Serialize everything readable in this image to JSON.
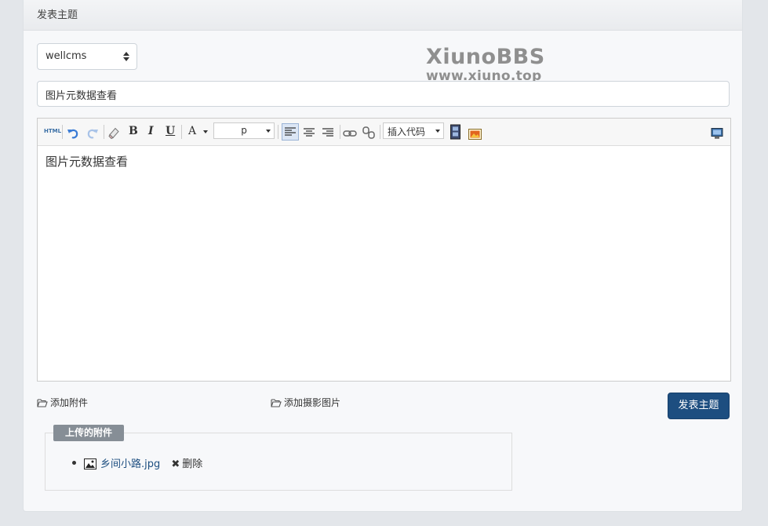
{
  "header": {
    "title": "发表主题"
  },
  "forum_select": {
    "value": "wellcms"
  },
  "watermark": {
    "line1": "XiunoBBS",
    "line2": "www.xiuno.top"
  },
  "subject": {
    "value": "图片元数据查看"
  },
  "toolbar": {
    "html_label": "HTML",
    "bold": "B",
    "italic": "I",
    "underline": "U",
    "font_color": "A",
    "font_size_value": "p",
    "insert_code_value": "插入代码"
  },
  "editor": {
    "content": "图片元数据查看"
  },
  "actions": {
    "add_attachment": "添加附件",
    "add_photo": "添加摄影图片",
    "publish": "发表主题"
  },
  "attachments": {
    "legend": "上传的附件",
    "items": [
      {
        "filename": "乡间小路.jpg",
        "delete_label": "删除"
      }
    ]
  },
  "icons": {
    "undo": "undo-icon",
    "redo": "redo-icon",
    "eraser": "eraser-icon",
    "link": "link-icon",
    "unlink": "unlink-icon",
    "video": "video-icon",
    "image": "image-icon",
    "fullscreen": "monitor-icon",
    "folder": "folder-open-icon",
    "picture": "picture-icon",
    "close": "x-icon"
  },
  "colors": {
    "accent": "#1d4e80",
    "legend_bg": "#868e96"
  }
}
